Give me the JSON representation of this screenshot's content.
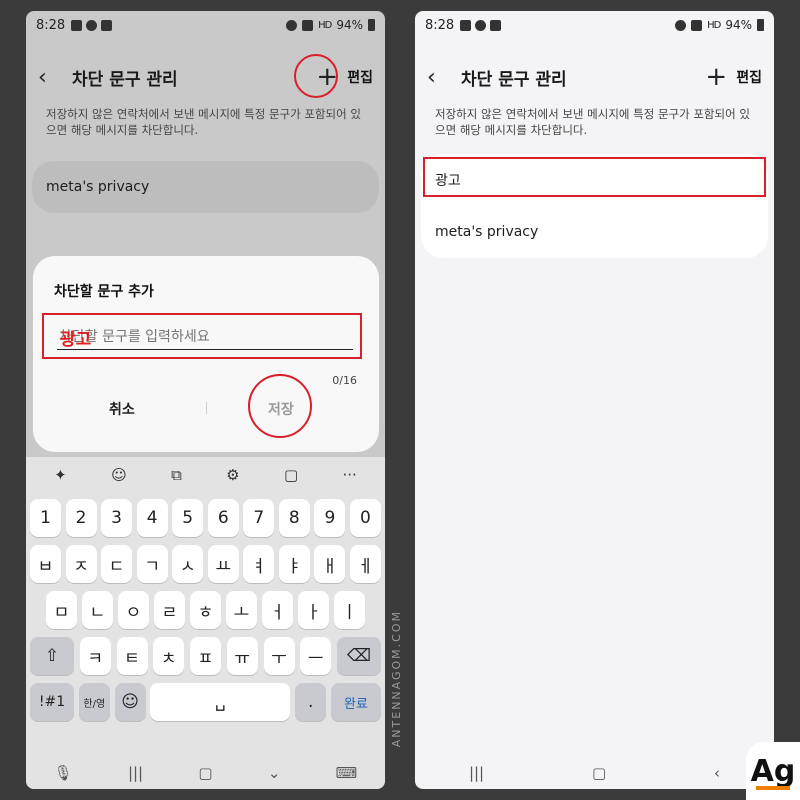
{
  "status_bar": {
    "time": "8:28",
    "signal_label": "HD",
    "battery": "94%"
  },
  "screen": {
    "title": "차단 문구 관리",
    "edit_label": "편집",
    "description": "저장하지 않은 연락처에서 보낸 메시지에 특정 문구가 포함되어 있으면 해당 메시지를 차단합니다."
  },
  "left": {
    "list": [
      "meta's privacy"
    ],
    "dialog": {
      "title": "차단할 문구 추가",
      "placeholder": "차단할 문구를 입력하세요",
      "typed_annotation": "광고",
      "counter": "0/16",
      "cancel_label": "취소",
      "save_label": "저장"
    },
    "keyboard": {
      "toolbar": [
        "✦",
        "☺",
        "⧉",
        "⚙",
        "▢",
        "···"
      ],
      "numbers": [
        "1",
        "2",
        "3",
        "4",
        "5",
        "6",
        "7",
        "8",
        "9",
        "0"
      ],
      "row1": [
        "ㅂ",
        "ㅈ",
        "ㄷ",
        "ㄱ",
        "ㅅ",
        "ㅛ",
        "ㅕ",
        "ㅑ",
        "ㅐ",
        "ㅔ"
      ],
      "row2": [
        "ㅁ",
        "ㄴ",
        "ㅇ",
        "ㄹ",
        "ㅎ",
        "ㅗ",
        "ㅓ",
        "ㅏ",
        "ㅣ"
      ],
      "row3": [
        "ㅋ",
        "ㅌ",
        "ㅊ",
        "ㅍ",
        "ㅠ",
        "ㅜ",
        "ㅡ"
      ],
      "shift": "⇧",
      "backspace": "⌫",
      "symbols": "!#1",
      "lang": "한/영",
      "emoji": "☺",
      "space": "␣",
      "period": ".",
      "done": "완료"
    }
  },
  "right": {
    "list": [
      "광고",
      "meta's privacy"
    ]
  },
  "watermark": "ANTENNAGOM.COM",
  "logo_text": "Ag"
}
